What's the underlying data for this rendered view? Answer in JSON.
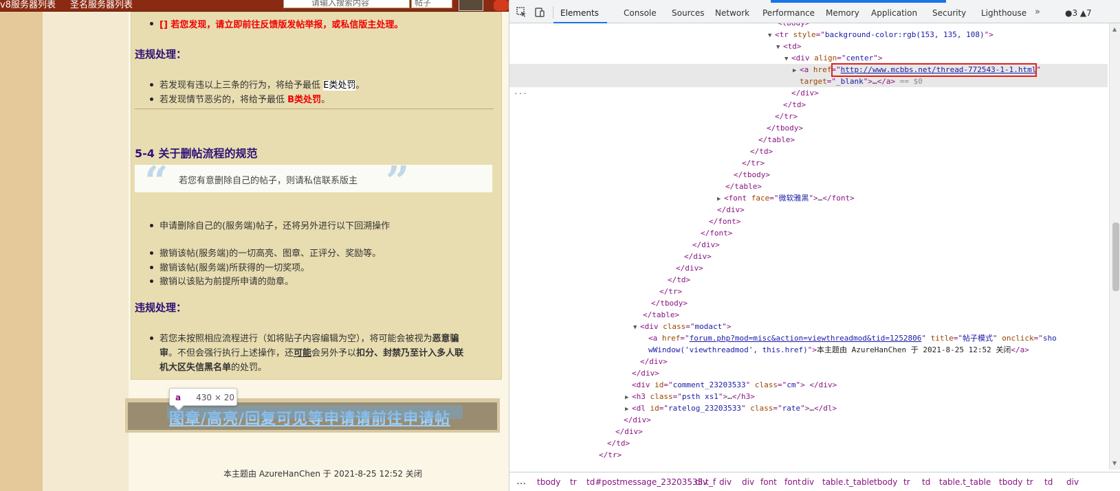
{
  "left_page": {
    "topbar": {
      "nav1": "v8服务器列表",
      "nav2": "圣名服务器列表",
      "search_placeholder": "请输入搜索内容",
      "search_scope": "帖子"
    },
    "rule_line_top": "[] 若您发现，请立即前往反馈版发帖举报，或私信版主处理。",
    "section_penalty_1": "违规处理：",
    "penalty_1_items": [
      {
        "pre": "若发现有违以上三条的行为，将给予最低 ",
        "hl": "E类处罚",
        "post": "。"
      },
      {
        "pre": "若发现情节恶劣的，将给予最低 ",
        "hl": "B类处罚",
        "post": "。"
      }
    ],
    "section_title": "5-4 关于删帖流程的规范",
    "quote_text": "若您有意删除自己的帖子，则请私信联系版主",
    "quote_open": "“",
    "quote_close": "”",
    "list_a": "申请删除自己的(服务端)帖子，还将另外进行以下回溯操作",
    "list_b": [
      "撤销该帖(服务端)的一切高亮、图章、正评分、奖励等。",
      "撤销该帖(服务端)所获得的一切奖项。",
      "撤销以该贴为前提所申请的勋章。"
    ],
    "section_penalty_2": "违规处理：",
    "penalty_2": {
      "line1_pre": "若您未按照相应流程进行（如将贴子内容编辑为空），将可能会被视为",
      "line1_bold": "恶意骗",
      "line2_bold1": "审",
      "line2_pre": "。不但会强行执行上述操作，还",
      "line2_u": "可能",
      "line2_mid": "会另外予以",
      "line2_bold2": "扣分、封禁乃至计入多人联",
      "line3_bold": "机大区失信黑名单",
      "line3_post": "的处罚。"
    },
    "link_bar_text": "图章/高亮/回复可见等申请请前往申请帖",
    "tooltip": {
      "tag": "a",
      "size": "430 × 20"
    },
    "footer": "本主题由 AzureHanChen 于 2021-8-25 12:52 关闭"
  },
  "devtools": {
    "tabs": [
      "Elements",
      "Console",
      "Sources",
      "Network",
      "Performance",
      "Memory",
      "Application",
      "Security",
      "Lighthouse"
    ],
    "active_tab": "Elements",
    "more_tabs": "»",
    "counters": "●3 ▲7",
    "tree": [
      {
        "indent": 0,
        "html": "<tbody>"
      },
      {
        "indent": 0,
        "html": "<tr style=\"background-color:rgb(153, 135, 108)\">"
      },
      {
        "indent": 0,
        "html": "<td>"
      },
      {
        "indent": 0,
        "html": "<div align=\"center\">"
      }
    ],
    "selected_href": "http://www.mcbbs.net/thread-772543-1-1.html",
    "selected_target": "_blank",
    "selected_suffix": "== $0",
    "modact_href": "forum.php?mod=misc&action=viewthreadmod&tid=1252806",
    "modact_title": "帖子模式",
    "modact_onclick1": "sho",
    "modact_onclick2": "wWindow('viewthreadmod', this.href)",
    "modact_text": "本主题由 AzureHanChen 于 2021-8-25 12:52 关闭",
    "font_face": "微软雅黑",
    "comment_id": "comment_23203533",
    "ratelog_id": "ratelog_23203533",
    "breadcrumbs": [
      "tbody",
      "tr",
      "td#postmessage_23203533.t_f",
      "div",
      "div",
      "div",
      "font",
      "font",
      "div",
      "table.t_table",
      "tbody",
      "tr",
      "td",
      "table.t_table",
      "tbody",
      "tr",
      "td",
      "div"
    ],
    "breadcrumb_ellipsis": "…"
  }
}
